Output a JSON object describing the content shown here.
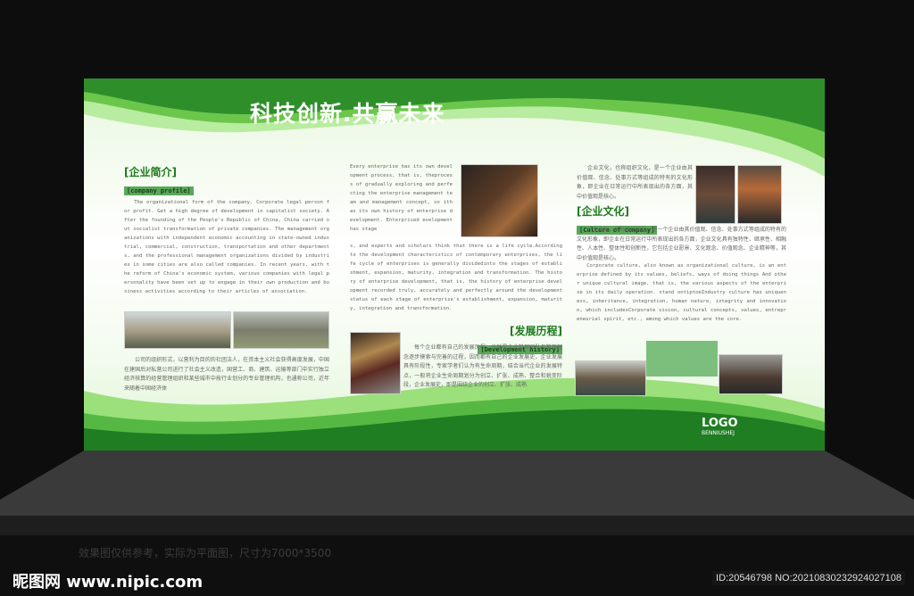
{
  "board": {
    "title": "科技创新.共赢未来",
    "profile": {
      "heading_cn": "[企业简介]",
      "heading_en": "[company profile]",
      "text_en": "The organizational form of the company. Corporate legal person for profit. Get a high degree of development in capitalist society. After the founding of the People's Republic of China, China carried out socialist transformation of private companies. The management organizations with independent economic accounting in state-owned industrial, commercial, construction, transportation and other departments, and the professional management organizations divided by industries in some cities are also called companies. In recent years, with the reform of China's economic system, various companies with legal personality have been set up to engage in their own production and business activities according to their articles of association.",
      "text_cn": "公司的组织形式，以营利为目的的社团法人，在资本主义社会获得高度发展，中国在建国后对私营公司进行了社会主义改造，国营工、商、建筑、运输等部门中实行独立经济核算的经营管理组织和某些城市中按行业划分的专业管理机构，也通称公司，近年来随着中国经济体"
    },
    "history": {
      "heading_cn": "[发展历程]",
      "heading_en": "[Development history]",
      "text_en_top": "Every enterprise has its own development process, that is, theprocess of gradually exploring and perfecting the enterprise management team and management concept, so ith as its own history of enterprise development. Enterprised evelopment has stage",
      "text_en_bottom": "s, and experts and scholars think that there is a life cycle.According to the development characteristics of contemporary enterprises, the life cycle of enterprises is generally dividedinto the stages of establishment, expansion, maturity, integration and transformation. The history of enterprise development, that is, the history of enterprise development recorded truly, accurately and perfectly around the development status of each stage of enterprise's establishment, expansion, maturity, integration and transformation.",
      "text_cn": "每个企业都有自己的发展历程，也就是企业管理团队与管理理念逐步摸索与完善的过程，因而都有自己的企业发展史，企业发展具有阶段性，专家学者们认为有生命周期，结合当代企业的发展特点，一般将企业生命周期划分为创立、扩张、成熟、整合和蜕变阶段，企业发展史，即是围绕企业的创立、扩张、成熟."
    },
    "culture": {
      "heading_cn": "[企业文化]",
      "heading_en": "[Culture of company]",
      "text_cn_top": "企业文化，也称组织文化，是一个企业由其价值观、信念、处事方式等组成的特有的文化形象，即企业在日常运行中所表现出的各方面，其中价值观是核心。",
      "text_cn": "企业文化，也称组织文化，是一个企业由其价值观、信念、处事方式等组成的特有的文化形象，即企业在日常运行中所表现出的各方面，企业文化具有独特性、继承性、相融性、人本性、整体性和创新性，它包括企业愿景、文化观念、价值观念、企业精神等，其中价值观是核心。",
      "text_en": "Corporate culture, also known as organizational culture, is an enterprise defined by its values, beliefs, ways of doing things And other unique cultural image, that is, the various aspects of the enterprise in its daily operation. stand ontiptoeIndustry culture has uniqueness, inheritance, integration, human nature, integrity and innovation, which includesCorporate vision, cultural concepts, values, entrepreneurial spirit, etc., among which values are the core."
    },
    "logo": {
      "main": "LOGO",
      "sub": "BENNIUSHEJ"
    }
  },
  "note": "效果图仅供参考，实际为平面图，尺寸为7000*3500",
  "watermark": {
    "site": "昵图网 www.nipic.com",
    "id": "ID:20546798 NO:20210830232924027108"
  },
  "colors": {
    "green_dark": "#1e7f24",
    "green_light": "#8fd96a",
    "background": "#0f0f0f"
  }
}
